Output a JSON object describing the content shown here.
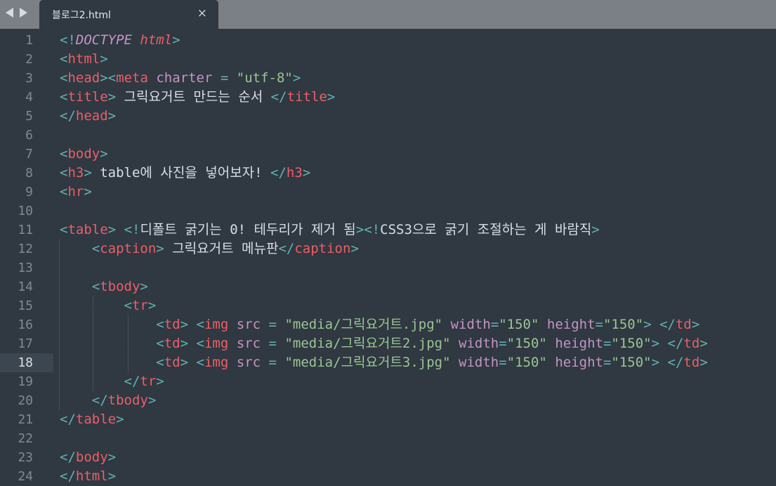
{
  "tab": {
    "title": "블로그2.html",
    "close_glyph": "×"
  },
  "active_line": 18,
  "lines": [
    "<!DOCTYPE html>",
    "<html>",
    "<head><meta charter = \"utf-8\">",
    "<title> 그릭요거트 만드는 순서 </title>",
    "</head>",
    "",
    "<body>",
    "<h3> table에 사진을 넣어보자! </h3>",
    "<hr>",
    "",
    "<table> <!디폴트 굵기는 0! 테두리가 제거 됨><!CSS3으로 굵기 조절하는 게 바람직>",
    "    <caption> 그릭요거트 메뉴판</caption>",
    "",
    "    <tbody>",
    "        <tr>",
    "            <td> <img src = \"media/그릭요거트.jpg\" width=\"150\" height=\"150\"> </td>",
    "            <td> <img src = \"media/그릭요거트2.jpg\" width=\"150\" height=\"150\"> </td>",
    "            <td> <img src = \"media/그릭요거트3.jpg\" width=\"150\" height=\"150\"> </td>",
    "        </tr>",
    "    </tbody>",
    "</table>",
    "",
    "</body>",
    "</html>"
  ],
  "colors": {
    "background": "#303841",
    "tabbar": "#7b7f86",
    "punctuation": "#5fb3b3",
    "tag": "#ec5f67",
    "attribute": "#c594c5",
    "string": "#99c794",
    "text": "#d8dee9"
  }
}
